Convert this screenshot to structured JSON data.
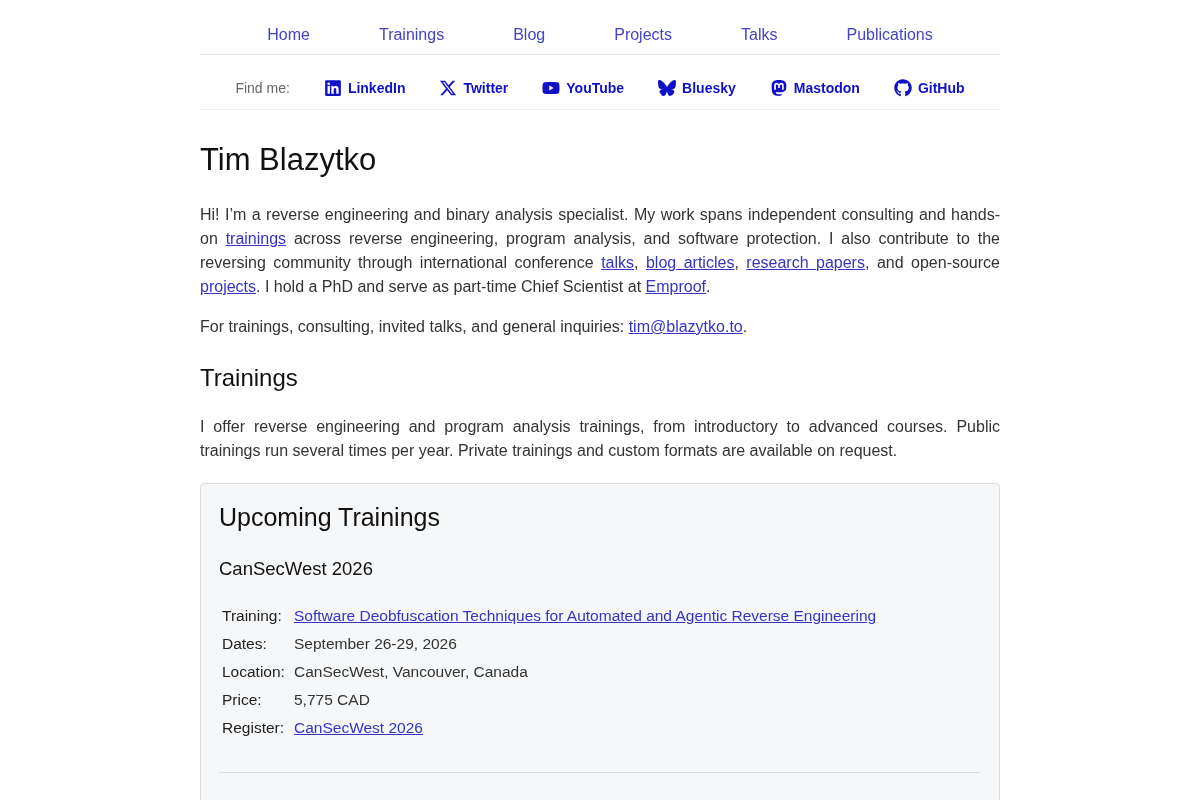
{
  "nav": {
    "items": [
      {
        "label": "Home"
      },
      {
        "label": "Trainings"
      },
      {
        "label": "Blog"
      },
      {
        "label": "Projects"
      },
      {
        "label": "Talks"
      },
      {
        "label": "Publications"
      }
    ]
  },
  "social": {
    "label": "Find me:",
    "links": [
      {
        "label": "LinkedIn"
      },
      {
        "label": "Twitter"
      },
      {
        "label": "YouTube"
      },
      {
        "label": "Bluesky"
      },
      {
        "label": "Mastodon"
      },
      {
        "label": "GitHub"
      }
    ]
  },
  "title": "Tim Blazytko",
  "intro": [
    [
      {
        "kind": "text",
        "text": "Hi! I’m a reverse engineering and binary analysis specialist. My work spans independent consulting and hands-on "
      },
      {
        "kind": "link",
        "text": "trainings"
      },
      {
        "kind": "text",
        "text": " across reverse engineering, program analysis, and software protection. I also contribute to the reversing community through international conference "
      },
      {
        "kind": "link",
        "text": "talks"
      },
      {
        "kind": "text",
        "text": ", "
      },
      {
        "kind": "link",
        "text": "blog articles"
      },
      {
        "kind": "text",
        "text": ", "
      },
      {
        "kind": "link",
        "text": "research papers"
      },
      {
        "kind": "text",
        "text": ", and open-source "
      },
      {
        "kind": "link",
        "text": "projects"
      },
      {
        "kind": "text",
        "text": ". I hold a PhD and serve as part-time Chief Scientist at "
      },
      {
        "kind": "link",
        "text": "Emproof"
      },
      {
        "kind": "text",
        "text": "."
      }
    ],
    [
      {
        "kind": "text",
        "text": "For trainings, consulting, invited talks, and general inquiries: "
      },
      {
        "kind": "link",
        "text": "tim@blazytko.to"
      },
      {
        "kind": "text",
        "text": "."
      }
    ]
  ],
  "trainings": {
    "heading": "Trainings",
    "description": "I offer reverse engineering and program analysis trainings, from introductory to advanced courses. Public trainings run several times per year. Private trainings and custom formats are available on request.",
    "upcoming": {
      "title": "Upcoming Trainings",
      "events": [
        {
          "name": "CanSecWest 2026",
          "details": [
            {
              "label": "Training:",
              "value": "Software Deobfuscation Techniques for Automated and Agentic Reverse Engineering",
              "kind": "link"
            },
            {
              "label": "Dates:",
              "value": "September 26-29, 2026",
              "kind": "text"
            },
            {
              "label": "Location:",
              "value": "CanSecWest, Vancouver, Canada",
              "kind": "text"
            },
            {
              "label": "Price:",
              "value": "5,775 CAD",
              "kind": "text"
            },
            {
              "label": "Register:",
              "value": "CanSecWest 2026",
              "kind": "link"
            }
          ]
        }
      ]
    }
  }
}
